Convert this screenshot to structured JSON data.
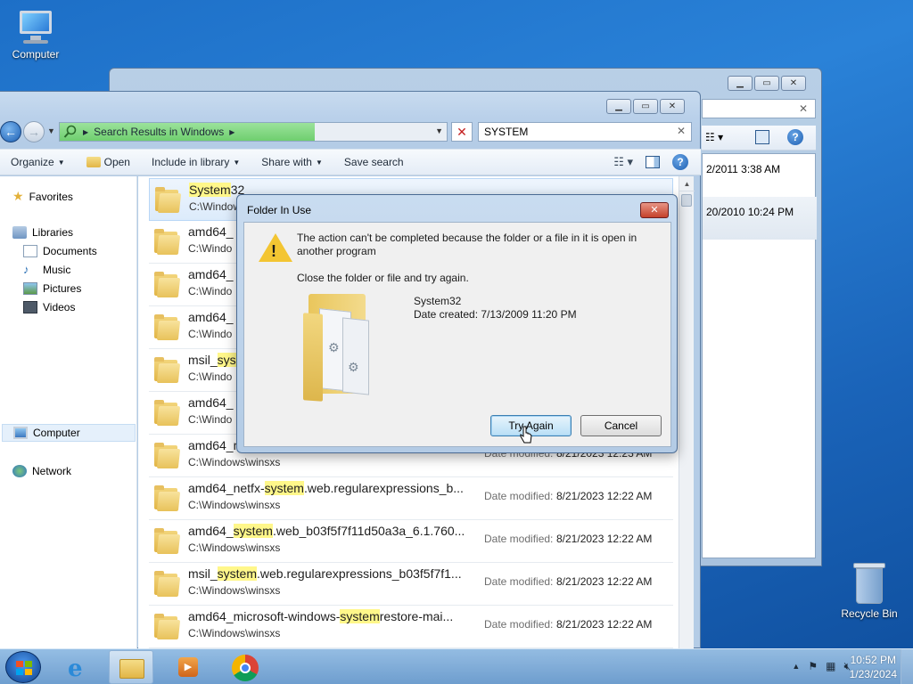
{
  "desktop": {
    "icons": [
      {
        "label": "Computer",
        "icon": "computer-icon"
      },
      {
        "label": "Recycle Bin",
        "icon": "recycle-bin-icon"
      }
    ]
  },
  "back_window": {
    "rows": [
      {
        "date": "2/2011 3:38 AM"
      },
      {
        "date": "20/2010 10:24 PM"
      }
    ]
  },
  "explorer": {
    "address": {
      "label": "Search Results in Windows",
      "progress": 0.66
    },
    "search": {
      "value": "SYSTEM"
    },
    "commands": [
      "Organize",
      "Open",
      "Include in library",
      "Share with",
      "Save search"
    ],
    "nav": {
      "favorites": "Favorites",
      "libraries": "Libraries",
      "documents": "Documents",
      "music": "Music",
      "pictures": "Pictures",
      "videos": "Videos",
      "computer": "Computer",
      "network": "Network"
    },
    "date_modified_label": "Date modified:",
    "files": [
      {
        "pre": "",
        "hit": "System",
        "post": "32",
        "path": "C:\\Windows",
        "date": ""
      },
      {
        "pre": "amd64_",
        "hit": "",
        "post": "",
        "path": "C:\\Windo",
        "date": ""
      },
      {
        "pre": "amd64_",
        "hit": "",
        "post": "",
        "path": "C:\\Windo",
        "date": ""
      },
      {
        "pre": "amd64_",
        "hit": "",
        "post": "",
        "path": "C:\\Windo",
        "date": ""
      },
      {
        "pre": "msil_",
        "hit": "sys",
        "post": "",
        "path": "C:\\Windo",
        "date": ""
      },
      {
        "pre": "amd64_",
        "hit": "",
        "post": "",
        "path": "C:\\Windo",
        "date": ""
      },
      {
        "pre": "amd64_microsoft-windows-",
        "hit": "system",
        "post": "restore-mai...",
        "path": "C:\\Windows\\winsxs",
        "date": "8/21/2023 12:23 AM"
      },
      {
        "pre": "amd64_netfx-",
        "hit": "system",
        "post": ".web.regularexpressions_b...",
        "path": "C:\\Windows\\winsxs",
        "date": "8/21/2023 12:22 AM"
      },
      {
        "pre": "amd64_",
        "hit": "system",
        "post": ".web_b03f5f7f11d50a3a_6.1.760...",
        "path": "C:\\Windows\\winsxs",
        "date": "8/21/2023 12:22 AM"
      },
      {
        "pre": "msil_",
        "hit": "system",
        "post": ".web.regularexpressions_b03f5f7f1...",
        "path": "C:\\Windows\\winsxs",
        "date": "8/21/2023 12:22 AM"
      },
      {
        "pre": "amd64_microsoft-windows-",
        "hit": "system",
        "post": "restore-mai...",
        "path": "C:\\Windows\\winsxs",
        "date": "8/21/2023 12:22 AM"
      }
    ]
  },
  "dialog": {
    "title": "Folder In Use",
    "close_glyph": "✕",
    "message": "The action can't be completed because the folder or a file in it is open in another program",
    "instruction": "Close the folder or file and try again.",
    "item_name": "System32",
    "item_date": "Date created: 7/13/2009 11:20 PM",
    "try_again": "Try Again",
    "cancel": "Cancel"
  },
  "taskbar": {
    "time": "10:52 PM",
    "date": "1/23/2024",
    "tray_up": "▲"
  },
  "colors": {
    "highlight": "#fff78a",
    "progress": "#6fcf6f"
  }
}
